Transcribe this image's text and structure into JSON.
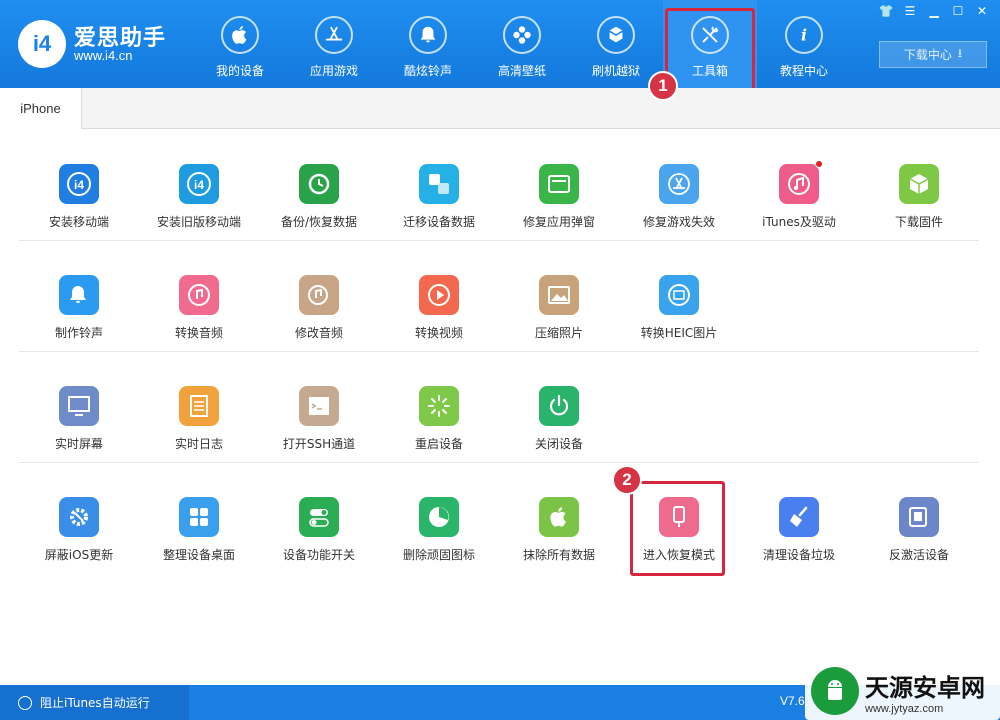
{
  "header": {
    "logo_mark": "i4",
    "app_name": "爱思助手",
    "app_url": "www.i4.cn",
    "download_label": "下载中心",
    "window_controls": [
      "shirt-icon",
      "menu-icon",
      "minimize-icon",
      "maximize-icon",
      "close-icon"
    ]
  },
  "nav": [
    {
      "label": "我的设备",
      "icon": "apple-icon"
    },
    {
      "label": "应用游戏",
      "icon": "appstore-icon"
    },
    {
      "label": "酷炫铃声",
      "icon": "bell-icon"
    },
    {
      "label": "高清壁纸",
      "icon": "flower-icon"
    },
    {
      "label": "刷机越狱",
      "icon": "box-icon"
    },
    {
      "label": "工具箱",
      "icon": "tools-icon",
      "active": true
    },
    {
      "label": "教程中心",
      "icon": "info-icon"
    }
  ],
  "tabs": [
    {
      "label": "iPhone"
    }
  ],
  "tools": {
    "row1": [
      {
        "label": "安装移动端",
        "icon": "i4-icon",
        "color": "#1f7ee0"
      },
      {
        "label": "安装旧版移动端",
        "icon": "i4-icon",
        "color": "#1f9be0"
      },
      {
        "label": "备份/恢复数据",
        "icon": "backup-icon",
        "color": "#2aa24a"
      },
      {
        "label": "迁移设备数据",
        "icon": "migrate-icon",
        "color": "#26b1e6"
      },
      {
        "label": "修复应用弹窗",
        "icon": "appleid-icon",
        "color": "#3ab54a"
      },
      {
        "label": "修复游戏失效",
        "icon": "appstore-icon",
        "color": "#4aa4ee"
      },
      {
        "label": "iTunes及驱动",
        "icon": "music-icon",
        "color": "#ef5c8a"
      },
      {
        "label": "下载固件",
        "icon": "cube-icon",
        "color": "#7fc846"
      }
    ],
    "row2": [
      {
        "label": "制作铃声",
        "icon": "bell-plus-icon",
        "color": "#2a9bf0"
      },
      {
        "label": "转换音频",
        "icon": "music-note-icon",
        "color": "#f06b8e"
      },
      {
        "label": "修改音频",
        "icon": "audio-edit-icon",
        "color": "#c9a587"
      },
      {
        "label": "转换视频",
        "icon": "play-icon",
        "color": "#f2694f"
      },
      {
        "label": "压缩照片",
        "icon": "photo-icon",
        "color": "#c7a27b"
      },
      {
        "label": "转换HEIC图片",
        "icon": "heic-icon",
        "color": "#3aa3ee"
      }
    ],
    "row3": [
      {
        "label": "实时屏幕",
        "icon": "monitor-icon",
        "color": "#6f8cc9"
      },
      {
        "label": "实时日志",
        "icon": "document-icon",
        "color": "#f2a23c"
      },
      {
        "label": "打开SSH通道",
        "icon": "terminal-icon",
        "color": "#c5a990"
      },
      {
        "label": "重启设备",
        "icon": "loading-icon",
        "color": "#7ec84a"
      },
      {
        "label": "关闭设备",
        "icon": "power-icon",
        "color": "#2ab36a"
      }
    ],
    "row4": [
      {
        "label": "屏蔽iOS更新",
        "icon": "gear-icon",
        "color": "#3a8ee8"
      },
      {
        "label": "整理设备桌面",
        "icon": "grid-icon",
        "color": "#3aa0ee"
      },
      {
        "label": "设备功能开关",
        "icon": "toggle-icon",
        "color": "#2bad55"
      },
      {
        "label": "删除顽固图标",
        "icon": "pie-icon",
        "color": "#2bb56a"
      },
      {
        "label": "抹除所有数据",
        "icon": "apple-icon",
        "color": "#7cc448"
      },
      {
        "label": "进入恢复模式",
        "icon": "phone-cable-icon",
        "color": "#ef6b8e",
        "highlighted": true
      },
      {
        "label": "清理设备垃圾",
        "icon": "broom-icon",
        "color": "#4a7ff0"
      },
      {
        "label": "反激活设备",
        "icon": "tablet-icon",
        "color": "#6c86c9"
      }
    ]
  },
  "annotations": {
    "step1": "1",
    "step2": "2"
  },
  "footer": {
    "itunes_toggle_label": "阻止iTunes自动运行",
    "version": "V7.6"
  },
  "watermark": {
    "name": "天源安卓网",
    "url": "www.jytyaz.com"
  },
  "colors": {
    "header": "#1a82e6",
    "highlight": "#d6273f",
    "footer": "#1a7fe2"
  }
}
